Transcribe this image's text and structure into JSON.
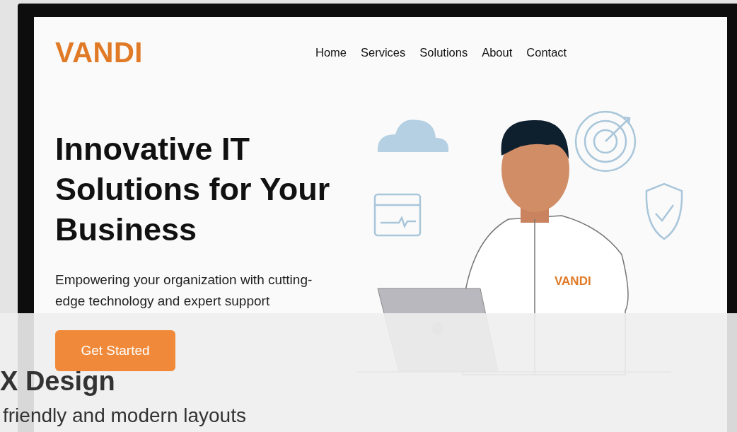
{
  "logo": "VANDI",
  "nav": [
    "Home",
    "Services",
    "Solutions",
    "About",
    "Contact"
  ],
  "hero": {
    "title": "Innovative IT Solutions for Your Business",
    "subtitle": "Empowering your organization with cutting-edge technology and expert support",
    "button": "Get Started"
  },
  "illustration": {
    "shirt_text": "VANDI"
  },
  "overlay": {
    "heading": "X Design",
    "text": "friendly and modern layouts"
  }
}
